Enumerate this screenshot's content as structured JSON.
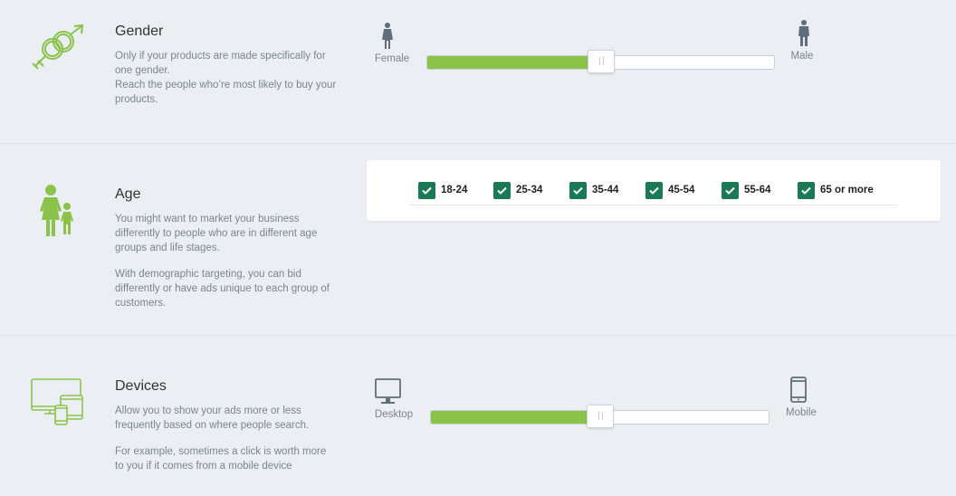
{
  "gender": {
    "title": "Gender",
    "desc": [
      "Only if your products are made specifically for one gender.",
      "Reach the people who’re most likely to buy your products."
    ],
    "left_label": "Female",
    "right_label": "Male",
    "slider_value": 0.5,
    "icon": "gender-symbols-icon"
  },
  "age": {
    "title": "Age",
    "desc": [
      "You might want to market your business differently to people who are in different age groups and life stages.",
      "With demographic targeting, you can bid differently or have ads unique to each group of customers."
    ],
    "icon": "adult-child-icon",
    "groups": [
      {
        "label": "18-24",
        "checked": true
      },
      {
        "label": "25-34",
        "checked": true
      },
      {
        "label": "35-44",
        "checked": true
      },
      {
        "label": "45-54",
        "checked": true
      },
      {
        "label": "55-64",
        "checked": true
      },
      {
        "label": "65 or more",
        "checked": true
      }
    ]
  },
  "devices": {
    "title": "Devices",
    "desc": [
      "Allow you to show your ads more or less frequently based on where people search.",
      "For example, sometimes a click is worth more to you if it comes from a mobile device"
    ],
    "left_label": "Desktop",
    "right_label": "Mobile",
    "slider_value": 0.5,
    "icon": "devices-icon"
  },
  "colors": {
    "accent": "#8bc34a",
    "checkbox": "#1a7a55",
    "muted": "#7a8591",
    "person_icon": "#5f6e7a"
  }
}
